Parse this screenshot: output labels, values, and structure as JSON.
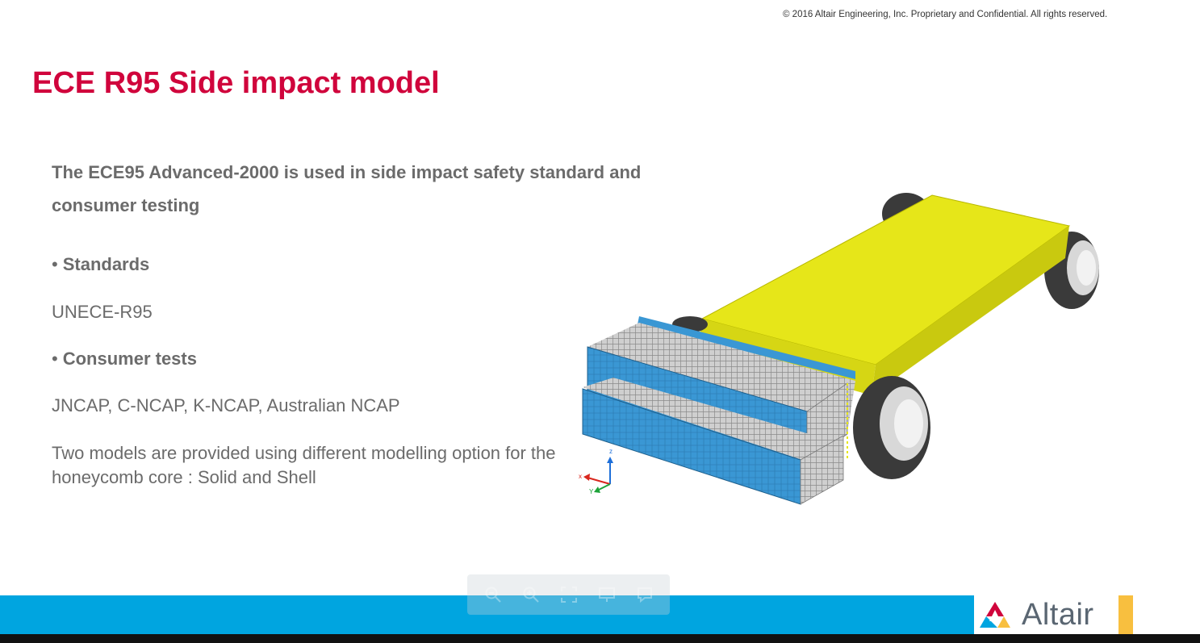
{
  "header": {
    "copyright": "© 2016 Altair Engineering, Inc. Proprietary and Confidential. All rights reserved."
  },
  "slide": {
    "title": "ECE R95 Side impact model",
    "intro": "The ECE95 Advanced-2000  is used in side impact safety standard and consumer testing",
    "sections": [
      {
        "heading": "Standards",
        "body": "UNECE-R95"
      },
      {
        "heading": "Consumer tests",
        "body": "JNCAP, C-NCAP, K-NCAP, Australian NCAP"
      }
    ],
    "note": "Two models are provided using different modelling option for the honeycomb core : Solid and Shell"
  },
  "figure": {
    "triad": {
      "x_label": "x",
      "y_label": "Y",
      "z_label": "z"
    }
  },
  "footer": {
    "logo_text": "Altair"
  },
  "toolbar": {
    "icons": [
      "zoom-out-icon",
      "zoom-in-icon",
      "fit-screen-icon",
      "present-icon",
      "comment-icon"
    ]
  },
  "colors": {
    "title": "#d0043c",
    "footer_bar": "#00a5e0",
    "barrier_body": "#e6e619",
    "honeycomb": "#3a97d4",
    "logo_accent": "#f8bf3f"
  }
}
